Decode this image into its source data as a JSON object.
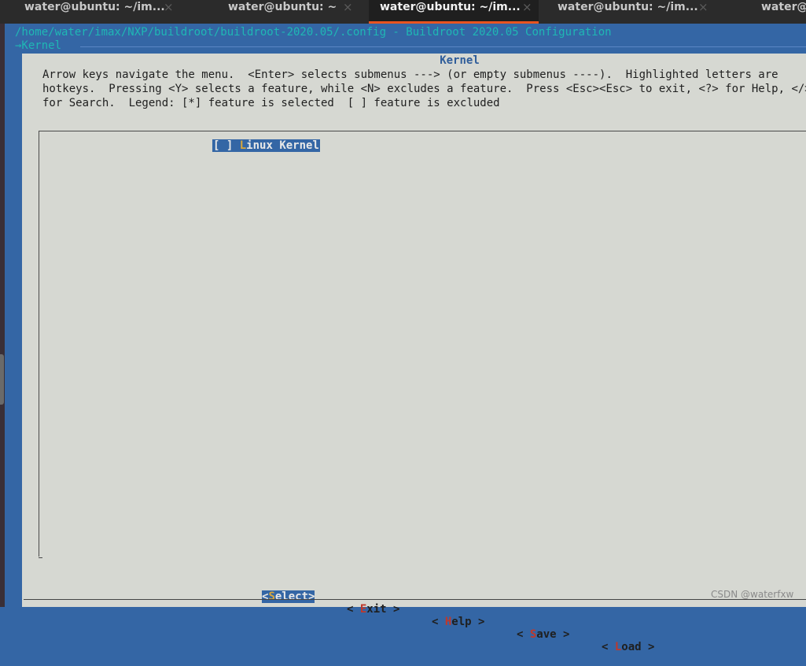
{
  "tabs": [
    {
      "label": "water@ubuntu: ~/im...",
      "active": false
    },
    {
      "label": "water@ubuntu: ~",
      "active": false
    },
    {
      "label": "water@ubuntu: ~/im...",
      "active": true
    },
    {
      "label": "water@ubuntu: ~/im...",
      "active": false
    },
    {
      "label": "water@ubuntu: ~/im...",
      "active": false
    }
  ],
  "tab_close_glyph": "×",
  "terminal": {
    "title": "/home/water/imax/NXP/buildroot/buildroot-2020.05/.config - Buildroot 2020.05 Configuration",
    "breadcrumb": "→Kernel "
  },
  "dialog": {
    "title": "Kernel",
    "help_lines": [
      "Arrow keys navigate the menu.  <Enter> selects submenus ---> (or empty submenus ----).  Highlighted letters are",
      "hotkeys.  Pressing <Y> selects a feature, while <N> excludes a feature.  Press <Esc><Esc> to exit, <?> for Help, </>",
      "for Search.  Legend: [*] feature is selected  [ ] feature is excluded"
    ]
  },
  "menu": {
    "items": [
      {
        "checkbox": "[ ]",
        "hotkey": "L",
        "rest": "inux Kernel",
        "selected": true
      }
    ]
  },
  "buttons": [
    {
      "open": "<",
      "hotkey": "S",
      "rest": "elect",
      "close": ">",
      "selected": true
    },
    {
      "open": "< ",
      "hotkey": "E",
      "rest": "xit",
      "close": " >",
      "selected": false
    },
    {
      "open": "< ",
      "hotkey": "H",
      "rest": "elp",
      "close": " >",
      "selected": false
    },
    {
      "open": "< ",
      "hotkey": "S",
      "rest": "ave",
      "close": " >",
      "selected": false
    },
    {
      "open": "< ",
      "hotkey": "L",
      "rest": "oad",
      "close": " >",
      "selected": false
    }
  ],
  "watermark": "CSDN @waterfxw",
  "colors": {
    "terminal_bg": "#3466a5",
    "dialog_bg": "#d6d8d2",
    "title_cyan": "#1fb7b4",
    "tab_accent": "#e95420",
    "hotkey_selected": "#d9a73b",
    "hotkey": "#c0392b"
  }
}
